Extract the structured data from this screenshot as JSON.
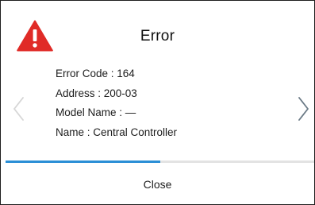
{
  "dialog": {
    "title": "Error",
    "icon": "warning-triangle-icon",
    "details": [
      {
        "label": "Error Code",
        "value": "164",
        "text": "Error Code : 164"
      },
      {
        "label": "Address",
        "value": "200-03",
        "text": "Address : 200-03"
      },
      {
        "label": "Model Name",
        "value": "—",
        "text": "Model Name : —"
      },
      {
        "label": "Name",
        "value": "Central Controller",
        "text": "Name : Central Controller"
      }
    ],
    "pager": {
      "progress_fraction": 0.5
    },
    "close_label": "Close"
  },
  "colors": {
    "warning": "#e02b27",
    "accent": "#2a8fd6",
    "track": "#e3e3e3",
    "chevron_disabled": "#d6d6d6",
    "chevron_active": "#6b7a86"
  }
}
